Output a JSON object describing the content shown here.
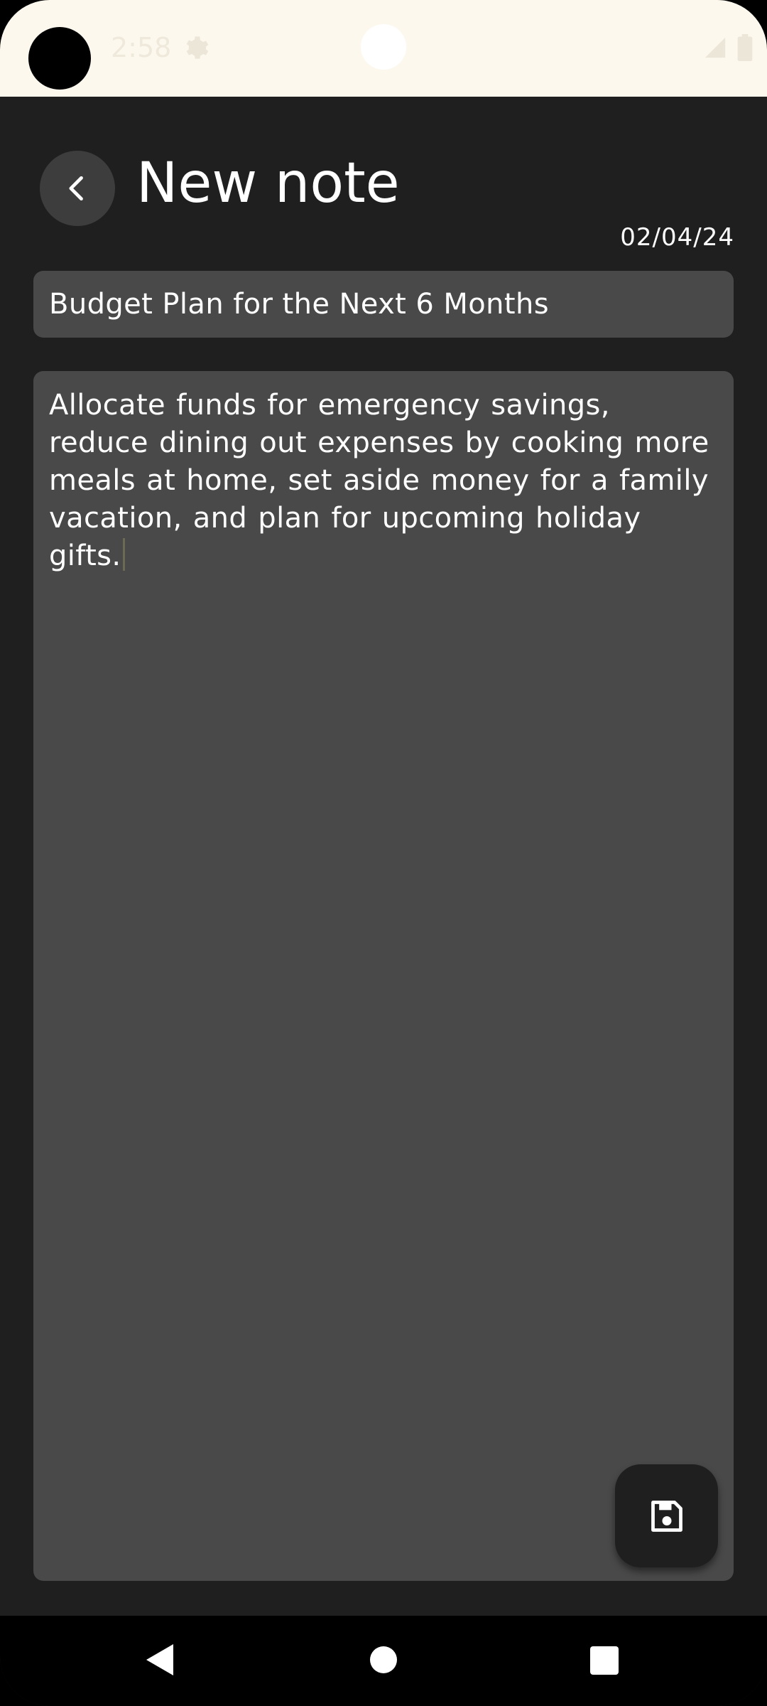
{
  "status_bar": {
    "time": "2:58",
    "icons": [
      "camera-dot",
      "gear-icon",
      "signal-icon",
      "battery-icon"
    ]
  },
  "header": {
    "back_icon": "chevron-left-icon",
    "title": "New note",
    "date": "02/04/24"
  },
  "note": {
    "title_value": "Budget Plan for the Next 6 Months",
    "body_value": "Allocate funds for emergency savings, reduce dining out expenses by cooking more meals at home, set aside money for a family vacation, and plan for upcoming holiday gifts."
  },
  "actions": {
    "save_icon": "floppy-disk-icon"
  },
  "nav_bar": {
    "icons": [
      "back-triangle-icon",
      "home-circle-icon",
      "recents-square-icon"
    ]
  },
  "colors": {
    "background": "#1f1f1f",
    "field": "#494949",
    "status_bar": "#fdf8ed",
    "text": "#ffffff"
  }
}
